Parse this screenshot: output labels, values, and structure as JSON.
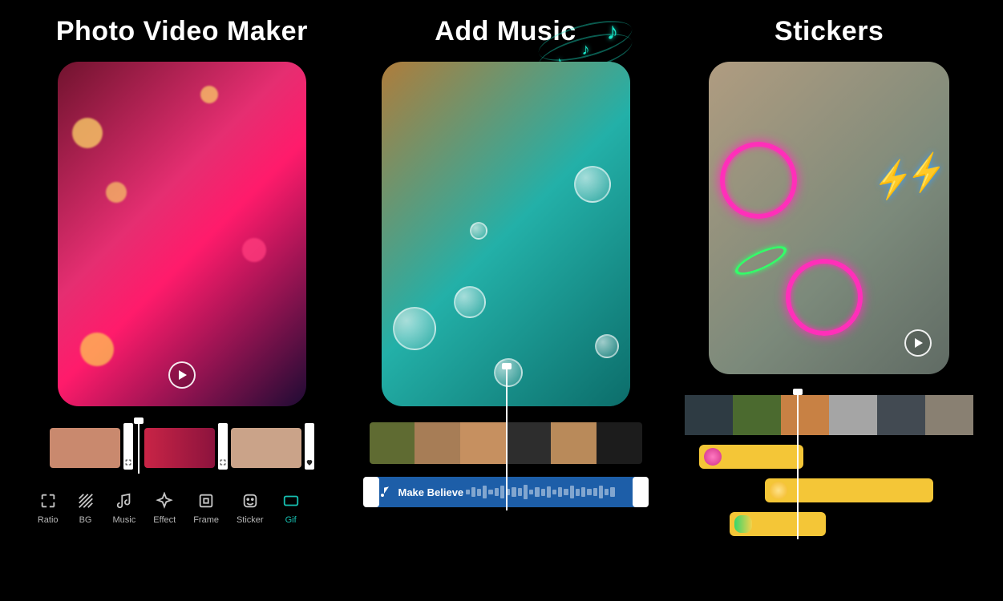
{
  "panels": [
    {
      "title": "Photo Video Maker"
    },
    {
      "title": "Add Music"
    },
    {
      "title": "Stickers"
    }
  ],
  "toolbar": [
    {
      "id": "ratio",
      "label": "Ratio"
    },
    {
      "id": "bg",
      "label": "BG"
    },
    {
      "id": "music",
      "label": "Music"
    },
    {
      "id": "effect",
      "label": "Effect"
    },
    {
      "id": "frame",
      "label": "Frame"
    },
    {
      "id": "sticker",
      "label": "Sticker"
    },
    {
      "id": "gif",
      "label": "Gif"
    }
  ],
  "music_track": {
    "name": "Make Believe"
  },
  "colors": {
    "accent_cyan": "#1be0cf",
    "neon_pink": "#ff2fb9",
    "music_bar": "#1d5ea8",
    "sticker_track": "#f4c637"
  }
}
